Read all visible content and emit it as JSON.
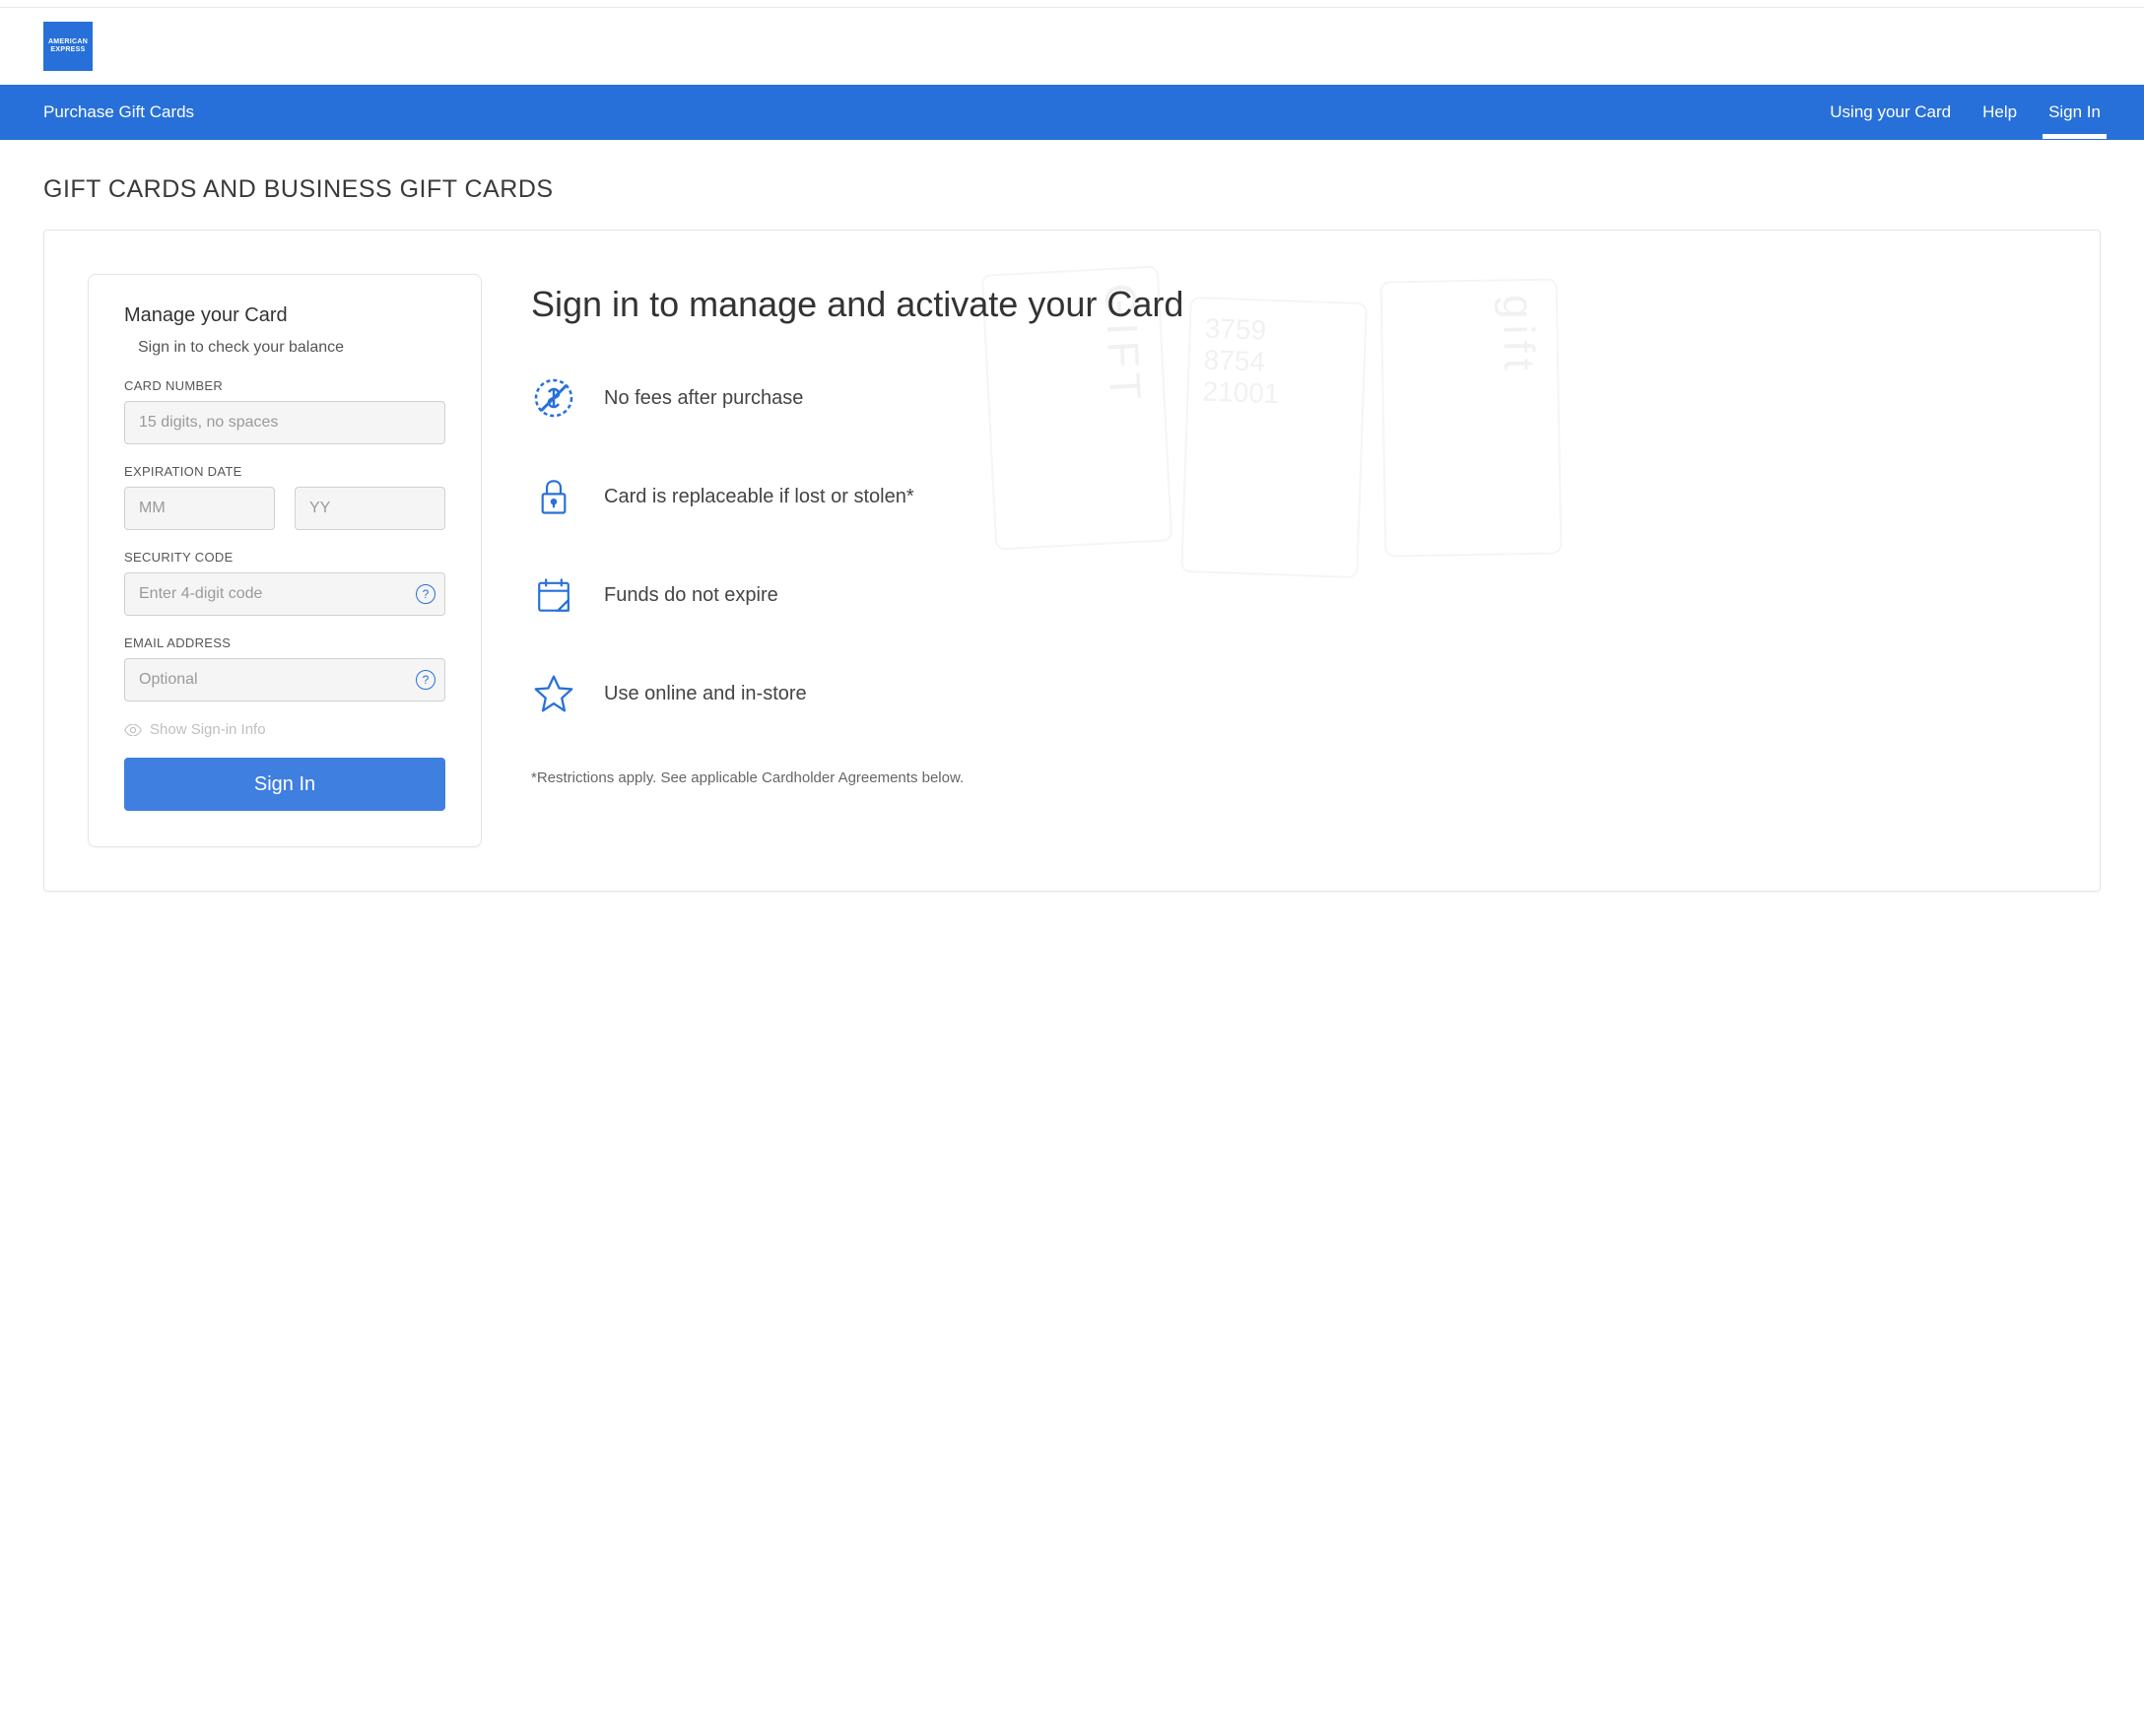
{
  "logo": {
    "line1": "AMERICAN",
    "line2": "EXPRESS"
  },
  "nav": {
    "left": "Purchase Gift Cards",
    "items": [
      "Using your Card",
      "Help",
      "Sign In"
    ],
    "active": 2
  },
  "page_title": "GIFT CARDS AND BUSINESS GIFT CARDS",
  "form": {
    "heading": "Manage your Card",
    "subtitle": "Sign in to check your balance",
    "card_number_label": "CARD NUMBER",
    "card_number_placeholder": "15 digits, no spaces",
    "expiration_label": "EXPIRATION DATE",
    "exp_mm_placeholder": "MM",
    "exp_yy_placeholder": "YY",
    "security_label": "SECURITY CODE",
    "security_placeholder": "Enter 4-digit code",
    "email_label": "EMAIL ADDRESS",
    "email_placeholder": "Optional",
    "show_info": "Show Sign-in Info",
    "submit": "Sign In"
  },
  "info": {
    "title": "Sign in to manage and activate your Card",
    "benefits": [
      "No fees after purchase",
      "Card is replaceable if lost or stolen*",
      "Funds do not expire",
      "Use online and in-store"
    ],
    "disclaimer": "*Restrictions apply. See applicable Cardholder Agreements below."
  }
}
